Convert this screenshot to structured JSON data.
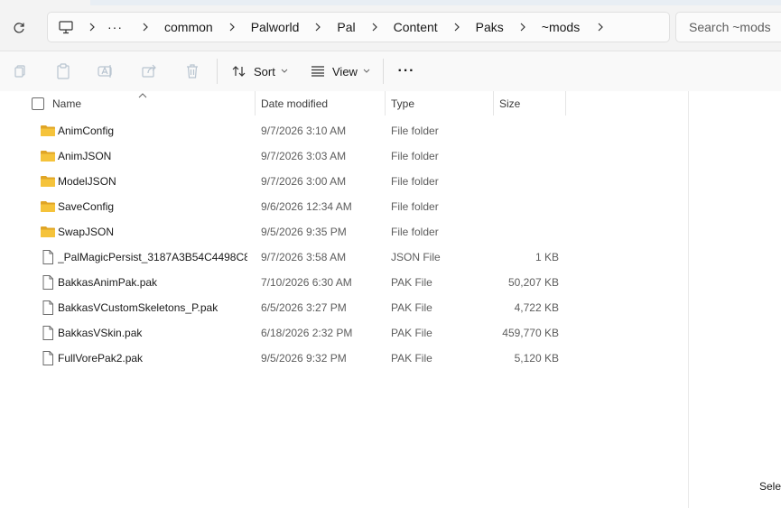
{
  "address_bar": {
    "overflow": "···",
    "crumbs": [
      "common",
      "Palworld",
      "Pal",
      "Content",
      "Paks",
      "~mods"
    ]
  },
  "search": {
    "placeholder": "Search ~mods"
  },
  "toolbar": {
    "sort_label": "Sort",
    "view_label": "View",
    "more_label": "···"
  },
  "columns": {
    "name": "Name",
    "date": "Date modified",
    "type": "Type",
    "size": "Size"
  },
  "files": [
    {
      "name": "AnimConfig",
      "date": "9/7/2026 3:10 AM",
      "type": "File folder",
      "size": "",
      "icon": "folder-icon"
    },
    {
      "name": "AnimJSON",
      "date": "9/7/2026 3:03 AM",
      "type": "File folder",
      "size": "",
      "icon": "folder-icon"
    },
    {
      "name": "ModelJSON",
      "date": "9/7/2026 3:00 AM",
      "type": "File folder",
      "size": "",
      "icon": "folder-icon"
    },
    {
      "name": "SaveConfig",
      "date": "9/6/2026 12:34 AM",
      "type": "File folder",
      "size": "",
      "icon": "folder-icon"
    },
    {
      "name": "SwapJSON",
      "date": "9/5/2026 9:35 PM",
      "type": "File folder",
      "size": "",
      "icon": "folder-icon"
    },
    {
      "name": "_PalMagicPersist_3187A3B54C4498C8...",
      "date": "9/7/2026 3:58 AM",
      "type": "JSON File",
      "size": "1 KB",
      "icon": "file-icon"
    },
    {
      "name": "BakkasAnimPak.pak",
      "date": "7/10/2026 6:30 AM",
      "type": "PAK File",
      "size": "50,207 KB",
      "icon": "file-icon"
    },
    {
      "name": "BakkasVCustomSkeletons_P.pak",
      "date": "6/5/2026 3:27 PM",
      "type": "PAK File",
      "size": "4,722 KB",
      "icon": "file-icon"
    },
    {
      "name": "BakkasVSkin.pak",
      "date": "6/18/2026 2:32 PM",
      "type": "PAK File",
      "size": "459,770 KB",
      "icon": "file-icon"
    },
    {
      "name": "FullVorePak2.pak",
      "date": "9/5/2026 9:32 PM",
      "type": "PAK File",
      "size": "5,120 KB",
      "icon": "file-icon"
    }
  ],
  "status": {
    "text": "Selec"
  },
  "colors": {
    "folder": "#f5c33b",
    "folder_dark": "#e0a526",
    "accent": "#0067c0"
  }
}
